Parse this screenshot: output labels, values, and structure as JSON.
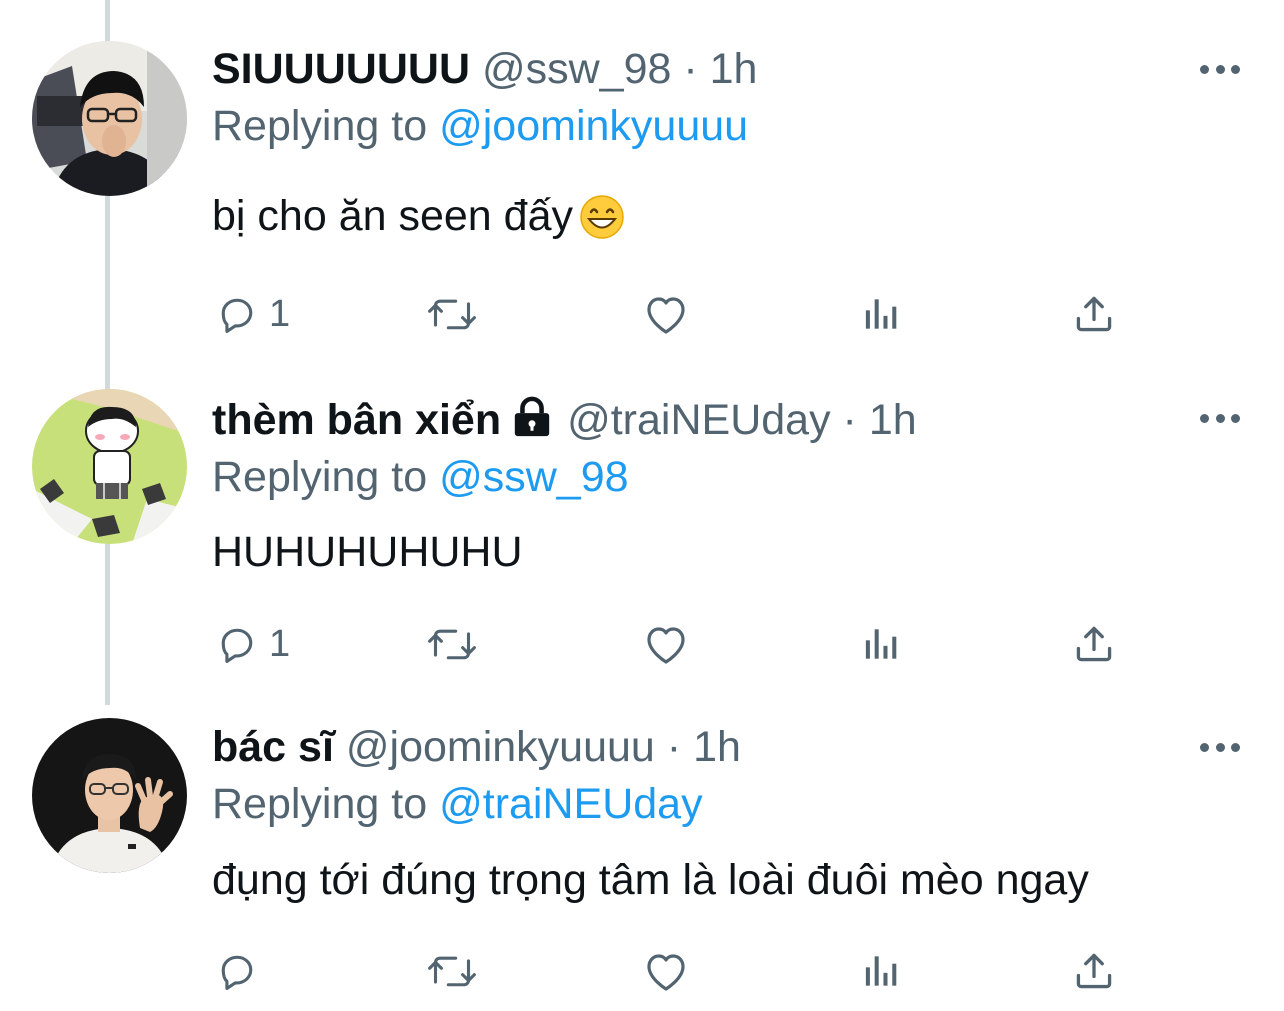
{
  "tweets": [
    {
      "name": "SIUUUUUUU",
      "handle": "@ssw_98",
      "separator": "·",
      "time": "1h",
      "replying_prefix": "Replying to",
      "replying_to": "@joominkyuuuu",
      "text": "bị cho ăn seen đấy",
      "emoji": "grinning-face-emoji",
      "reply_count": "1",
      "protected": false
    },
    {
      "name": "thèm bân xiển",
      "handle": "@traiNEUday",
      "separator": "·",
      "time": "1h",
      "replying_prefix": "Replying to",
      "replying_to": "@ssw_98",
      "text": "HUHUHUHUHU",
      "reply_count": "1",
      "protected": true
    },
    {
      "name": "bác sĩ",
      "handle": "@joominkyuuuu",
      "separator": "·",
      "time": "1h",
      "replying_prefix": "Replying to",
      "replying_to": "@traiNEUday",
      "text": "đụng tới đúng trọng tâm là loài đuôi mèo ngay",
      "reply_count": "",
      "protected": false
    }
  ],
  "icons": {
    "reply": "reply-icon",
    "retweet": "retweet-icon",
    "like": "heart-icon",
    "views": "analytics-icon",
    "share": "share-icon",
    "more": "more-icon",
    "lock": "lock-icon"
  },
  "colors": {
    "text": "#0f1419",
    "secondary": "#536471",
    "mention": "#1d9bf0",
    "thread_line": "#cfd9de"
  }
}
